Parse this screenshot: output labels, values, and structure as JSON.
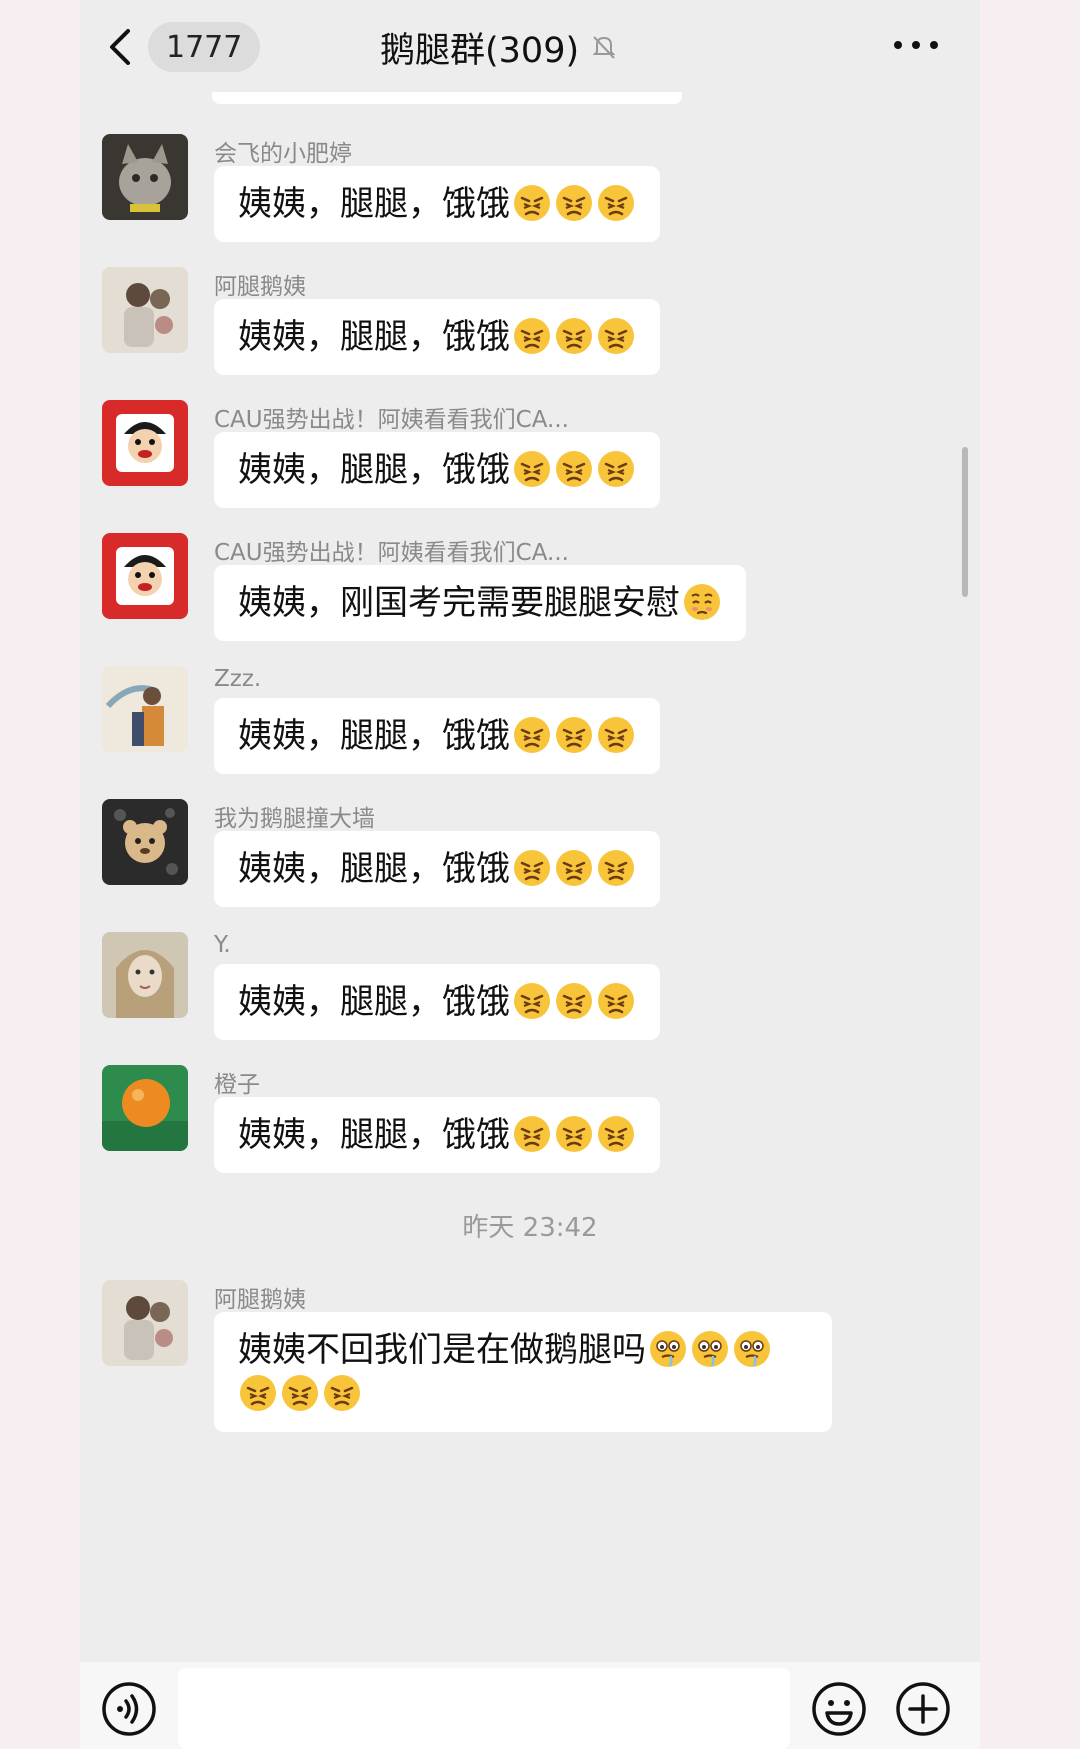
{
  "header": {
    "unread_count": "1777",
    "title": "鹅腿群(309)"
  },
  "messages": [
    {
      "sender": "会飞的小肥婷",
      "text": "姨姨，腿腿，饿饿",
      "emojis": [
        "angry",
        "angry",
        "angry"
      ],
      "avatar": "cat"
    },
    {
      "sender": "阿腿鹅姨",
      "text": "姨姨，腿腿，饿饿",
      "emojis": [
        "angry",
        "angry",
        "angry"
      ],
      "avatar": "couple"
    },
    {
      "sender": "CAU强势出战！阿姨看看我们CA...",
      "text": "姨姨，腿腿，饿饿",
      "emojis": [
        "angry",
        "angry",
        "angry"
      ],
      "avatar": "cartoon-boy"
    },
    {
      "sender": "CAU强势出战！阿姨看看我们CA...",
      "text": "姨姨，刚国考完需要腿腿安慰",
      "emojis": [
        "pleading"
      ],
      "avatar": "cartoon-boy"
    },
    {
      "sender": "Zzz.",
      "text": "姨姨，腿腿，饿饿",
      "emojis": [
        "angry",
        "angry",
        "angry"
      ],
      "avatar": "illustration"
    },
    {
      "sender": "我为鹅腿撞大墙",
      "text": "姨姨，腿腿，饿饿",
      "emojis": [
        "angry",
        "angry",
        "angry"
      ],
      "avatar": "bear"
    },
    {
      "sender": "Y.",
      "text": "姨姨，腿腿，饿饿",
      "emojis": [
        "angry",
        "angry",
        "angry"
      ],
      "avatar": "girl"
    },
    {
      "sender": "橙子",
      "text": "姨姨，腿腿，饿饿",
      "emojis": [
        "angry",
        "angry",
        "angry"
      ],
      "avatar": "orange"
    }
  ],
  "timestamp": "昨天 23:42",
  "last_message": {
    "sender": "阿腿鹅姨",
    "text": "姨姨不回我们是在做鹅腿吗",
    "emojis_line1": [
      "drool",
      "drool",
      "drool"
    ],
    "emojis_line2": [
      "angry",
      "angry",
      "angry"
    ],
    "avatar": "couple"
  }
}
